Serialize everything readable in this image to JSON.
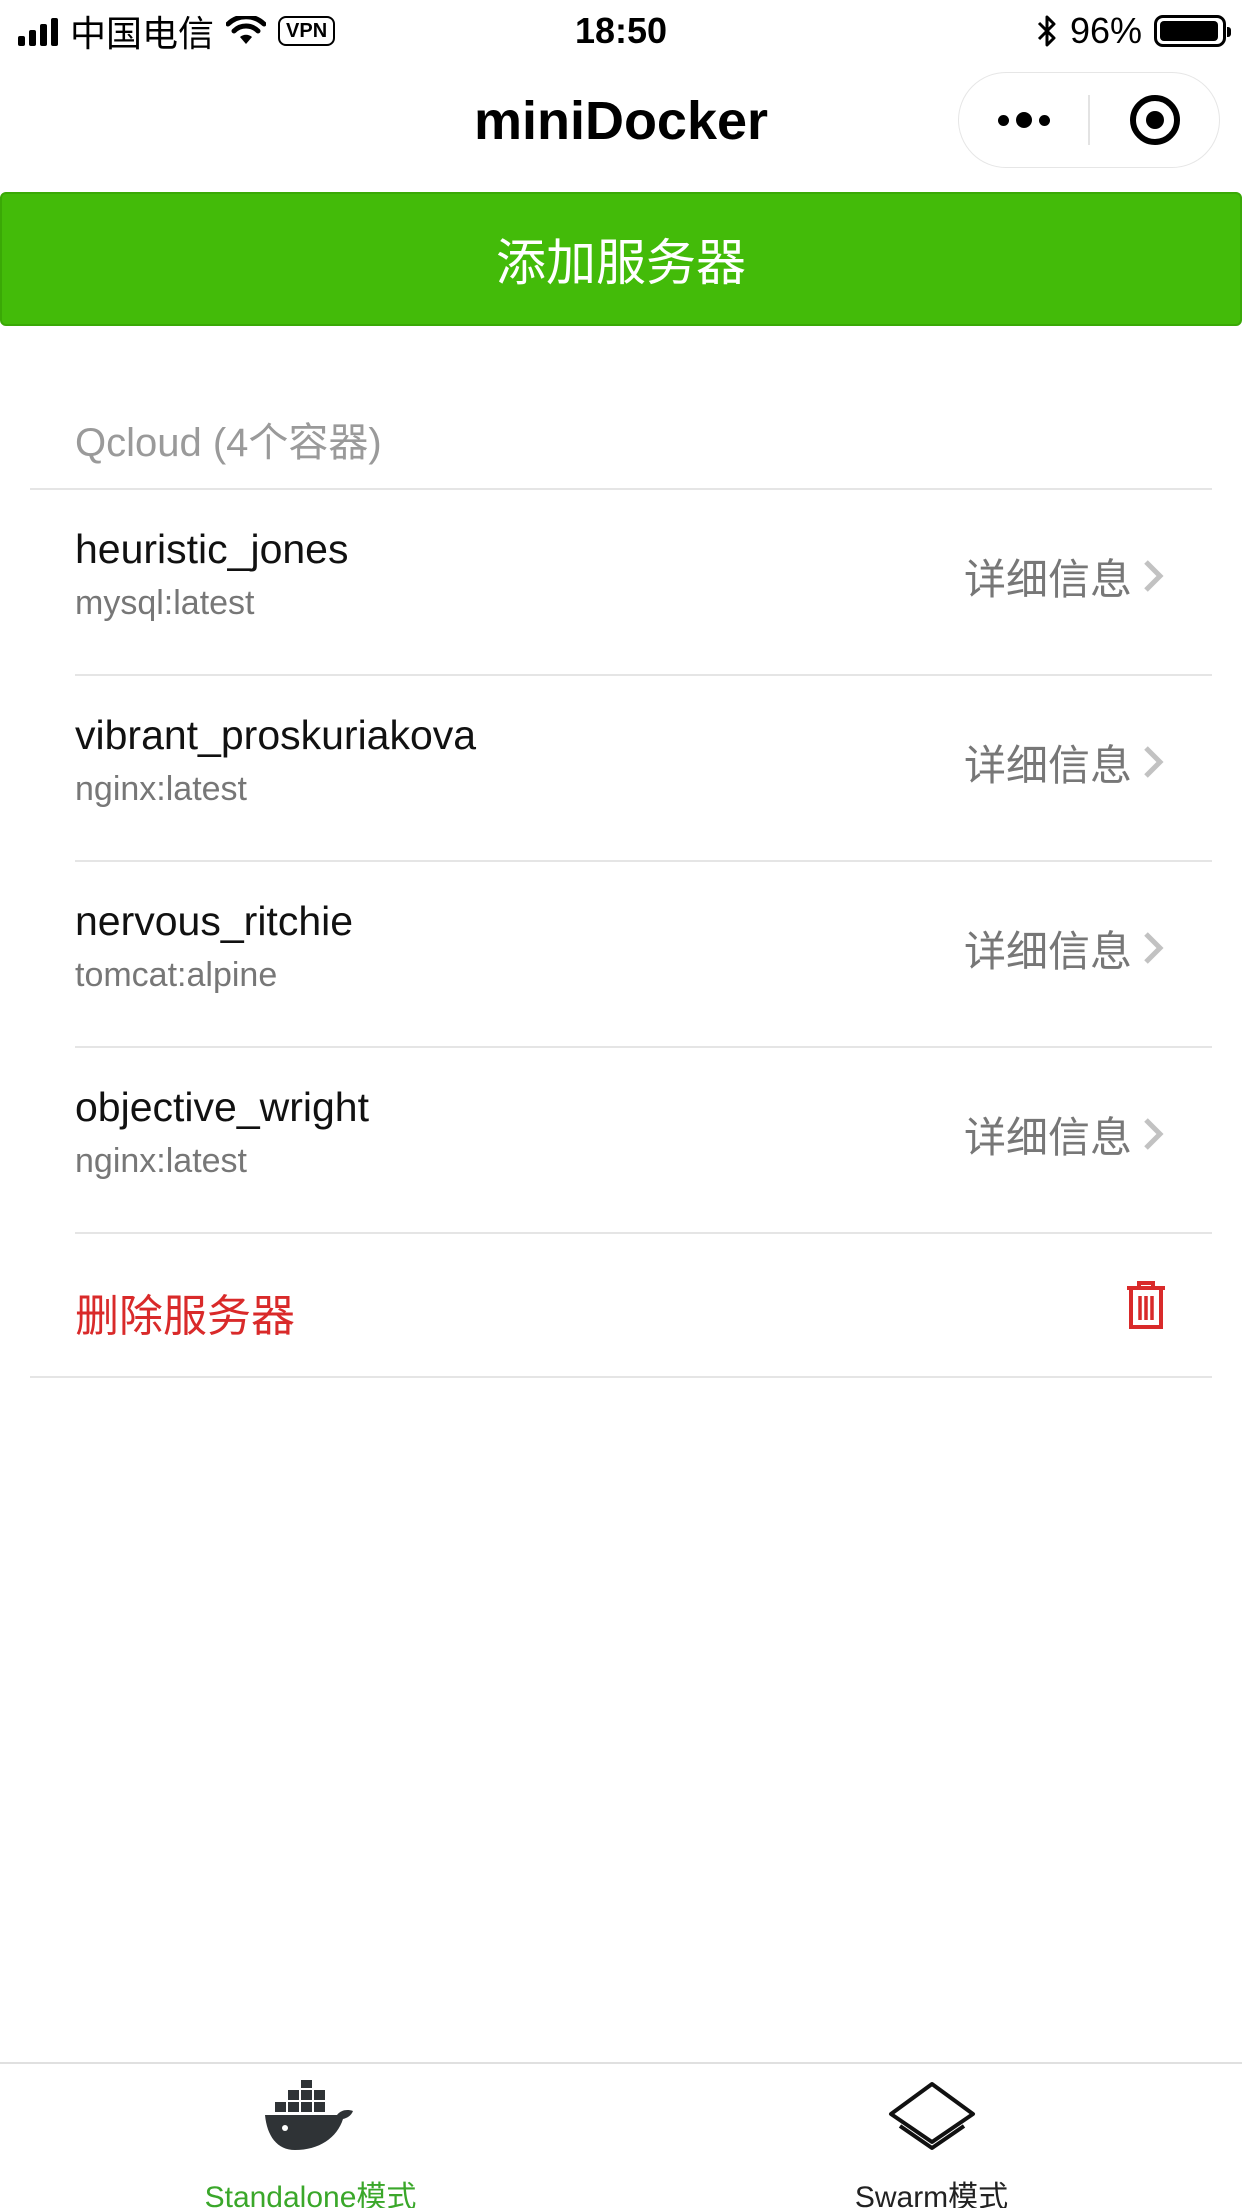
{
  "status_bar": {
    "carrier": "中国电信",
    "vpn": "VPN",
    "time": "18:50",
    "battery_percent": "96%",
    "battery_level": 0.96,
    "signal_bars": 4
  },
  "nav": {
    "title": "miniDocker"
  },
  "add_server_label": "添加服务器",
  "server": {
    "title": "Qcloud (4个容器)",
    "containers": [
      {
        "name": "heuristic_jones",
        "image": "mysql:latest",
        "detail": "详细信息"
      },
      {
        "name": "vibrant_proskuriakova",
        "image": "nginx:latest",
        "detail": "详细信息"
      },
      {
        "name": "nervous_ritchie",
        "image": "tomcat:alpine",
        "detail": "详细信息"
      },
      {
        "name": "objective_wright",
        "image": "nginx:latest",
        "detail": "详细信息"
      }
    ],
    "delete_label": "删除服务器"
  },
  "tabs": [
    {
      "label": "Standalone模式",
      "icon": "docker-whale-icon",
      "active": true
    },
    {
      "label": "Swarm模式",
      "icon": "layers-icon",
      "active": false
    }
  ],
  "colors": {
    "accent_green": "#43bb09",
    "active_tab": "#3aa72a",
    "danger_red": "#d92a2a",
    "secondary_text": "#777777"
  }
}
